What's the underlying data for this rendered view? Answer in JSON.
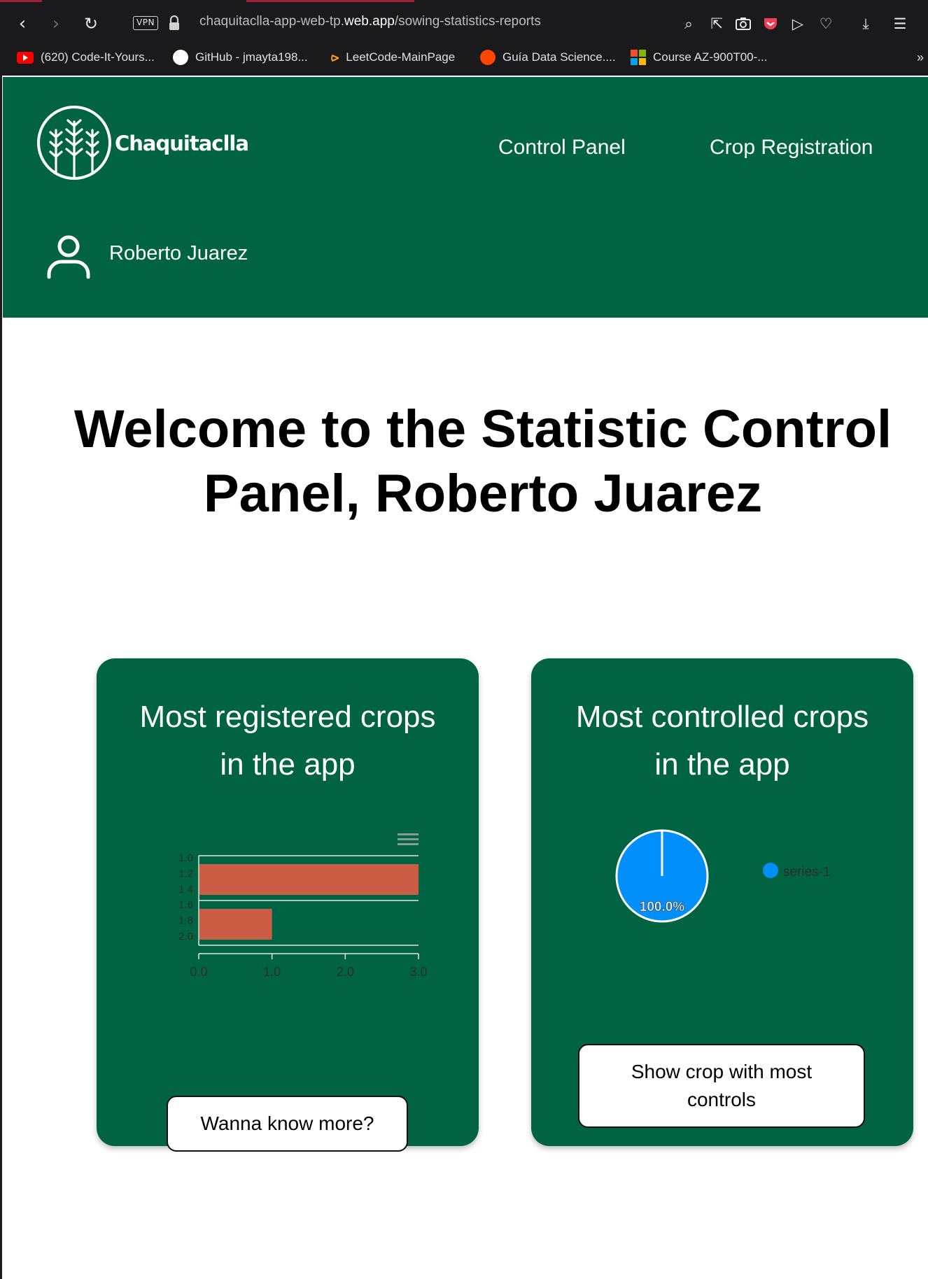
{
  "browser": {
    "url_host_prefix": "chaquitaclla-app-web-tp.",
    "url_host_domain": "web.app",
    "url_path": "/sowing-statistics-reports",
    "vpn_label": "VPN",
    "bookmarks": [
      {
        "label": "(620) Code-It-Yours...",
        "icon": "youtube-icon",
        "color": "#ff0000"
      },
      {
        "label": "GitHub - jmayta198...",
        "icon": "github-icon",
        "color": "#ffffff"
      },
      {
        "label": "LeetCode-MainPage",
        "icon": "leetcode-icon",
        "color": "#ffa116"
      },
      {
        "label": "Guía Data Science....",
        "icon": "reddit-icon",
        "color": "#ff4500"
      },
      {
        "label": "Course AZ-900T00-...",
        "icon": "microsoft-icon",
        "color": "#7fba00"
      }
    ],
    "overflow": "»"
  },
  "header": {
    "brand": "Chaquitaclla",
    "nav": [
      "Control Panel",
      "Crop Registration"
    ],
    "user_name": "Roberto Juarez",
    "bg_color": "#006341"
  },
  "main": {
    "welcome_line1": "Welcome to the Statistic Control",
    "welcome_line2": "Panel, Roberto Juarez"
  },
  "cards": {
    "registered": {
      "title_line1": "Most registered crops",
      "title_line2": "in the app",
      "button": "Wanna know more?"
    },
    "controlled": {
      "title_line1": "Most controlled crops",
      "title_line2": "in the app",
      "button_line1": "Show crop with most",
      "button_line2": "controls"
    }
  },
  "chart_data": [
    {
      "type": "bar",
      "orientation": "horizontal",
      "categories": [
        "1",
        "2"
      ],
      "values": [
        3,
        1
      ],
      "y_tick_labels": [
        "1.0",
        "1.2",
        "1.4",
        "1.6",
        "1.8",
        "2.0"
      ],
      "x_tick_labels": [
        "0.0",
        "1.0",
        "2.0",
        "3.0"
      ],
      "xlim": [
        0,
        3
      ],
      "bar_color": "#cd5c45",
      "menu_icon": "hamburger-menu-icon"
    },
    {
      "type": "pie",
      "labels": [
        "series-1"
      ],
      "values": [
        100
      ],
      "data_labels": [
        "100.0%"
      ],
      "colors": [
        "#008ffb"
      ],
      "legend": "right"
    }
  ]
}
